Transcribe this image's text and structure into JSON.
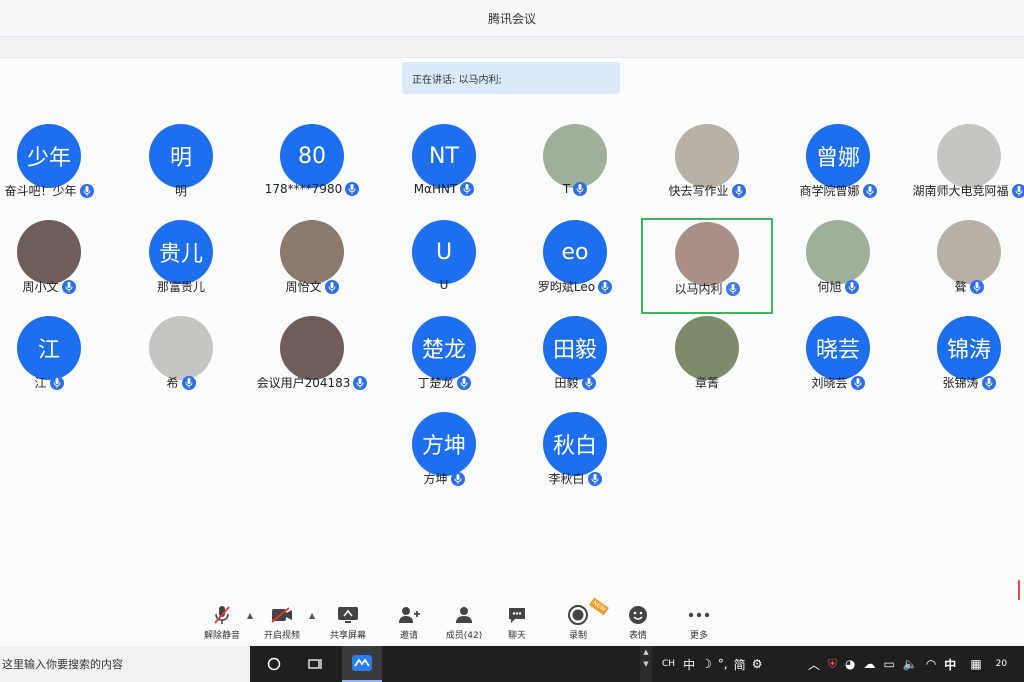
{
  "window": {
    "title": "腾讯会议"
  },
  "speaking": {
    "label": "正在讲话: 以马内利;"
  },
  "participants": [
    {
      "avatar": "少年",
      "name": "奋斗吧！少年",
      "photo": false
    },
    {
      "avatar": "明",
      "name": "明",
      "photo": false
    },
    {
      "avatar": "80",
      "name": "178****7980",
      "photo": false
    },
    {
      "avatar": "NT",
      "name": "MαHNT",
      "photo": false
    },
    {
      "avatar": "",
      "name": "T",
      "photo": true
    },
    {
      "avatar": "",
      "name": "快去写作业",
      "photo": true
    },
    {
      "avatar": "曾娜",
      "name": "商学院曾娜",
      "photo": false
    },
    {
      "avatar": "",
      "name": "湖南师大电竞阿福",
      "photo": true
    },
    {
      "avatar": "",
      "name": "周小文",
      "photo": true
    },
    {
      "avatar": "贵儿",
      "name": "那富贵儿",
      "photo": false
    },
    {
      "avatar": "",
      "name": "周怡文",
      "photo": true
    },
    {
      "avatar": "U",
      "name": "U",
      "photo": false
    },
    {
      "avatar": "eo",
      "name": "罗昀斌Leo",
      "photo": false
    },
    {
      "avatar": "",
      "name": "以马内利",
      "photo": true,
      "active": true
    },
    {
      "avatar": "",
      "name": "何旭",
      "photo": true
    },
    {
      "avatar": "",
      "name": "聱",
      "photo": true
    },
    {
      "avatar": "江",
      "name": "江",
      "photo": false
    },
    {
      "avatar": "",
      "name": "希",
      "photo": true
    },
    {
      "avatar": "",
      "name": "会议用户204183",
      "photo": true
    },
    {
      "avatar": "楚龙",
      "name": "丁楚龙",
      "photo": false
    },
    {
      "avatar": "田毅",
      "name": "田毅",
      "photo": false
    },
    {
      "avatar": "",
      "name": "章菁",
      "photo": true
    },
    {
      "avatar": "晓芸",
      "name": "刘晓芸",
      "photo": false
    },
    {
      "avatar": "锦涛",
      "name": "张锦涛",
      "photo": false
    },
    {
      "avatar": "方坤",
      "name": "方坤",
      "photo": false
    },
    {
      "avatar": "秋白",
      "name": "李秋白",
      "photo": false
    }
  ],
  "toolbar": {
    "unmute": "解除静音",
    "video": "开启视频",
    "share": "共享屏幕",
    "invite": "邀请",
    "members": "成员(42)",
    "chat": "聊天",
    "record": "录制",
    "record_badge": "NEW",
    "emoji": "表情",
    "more": "更多"
  },
  "taskbar": {
    "search_placeholder": "这里输入你要搜索的内容",
    "ime_ch": "CH",
    "ime_zh": "中",
    "ime_simplified": "简",
    "ime_zh2": "中",
    "clock": "20"
  },
  "colors": {
    "accent": "#1e6ff0",
    "active_border": "#3cb65a",
    "speaking_bg": "#dbe9fb"
  }
}
